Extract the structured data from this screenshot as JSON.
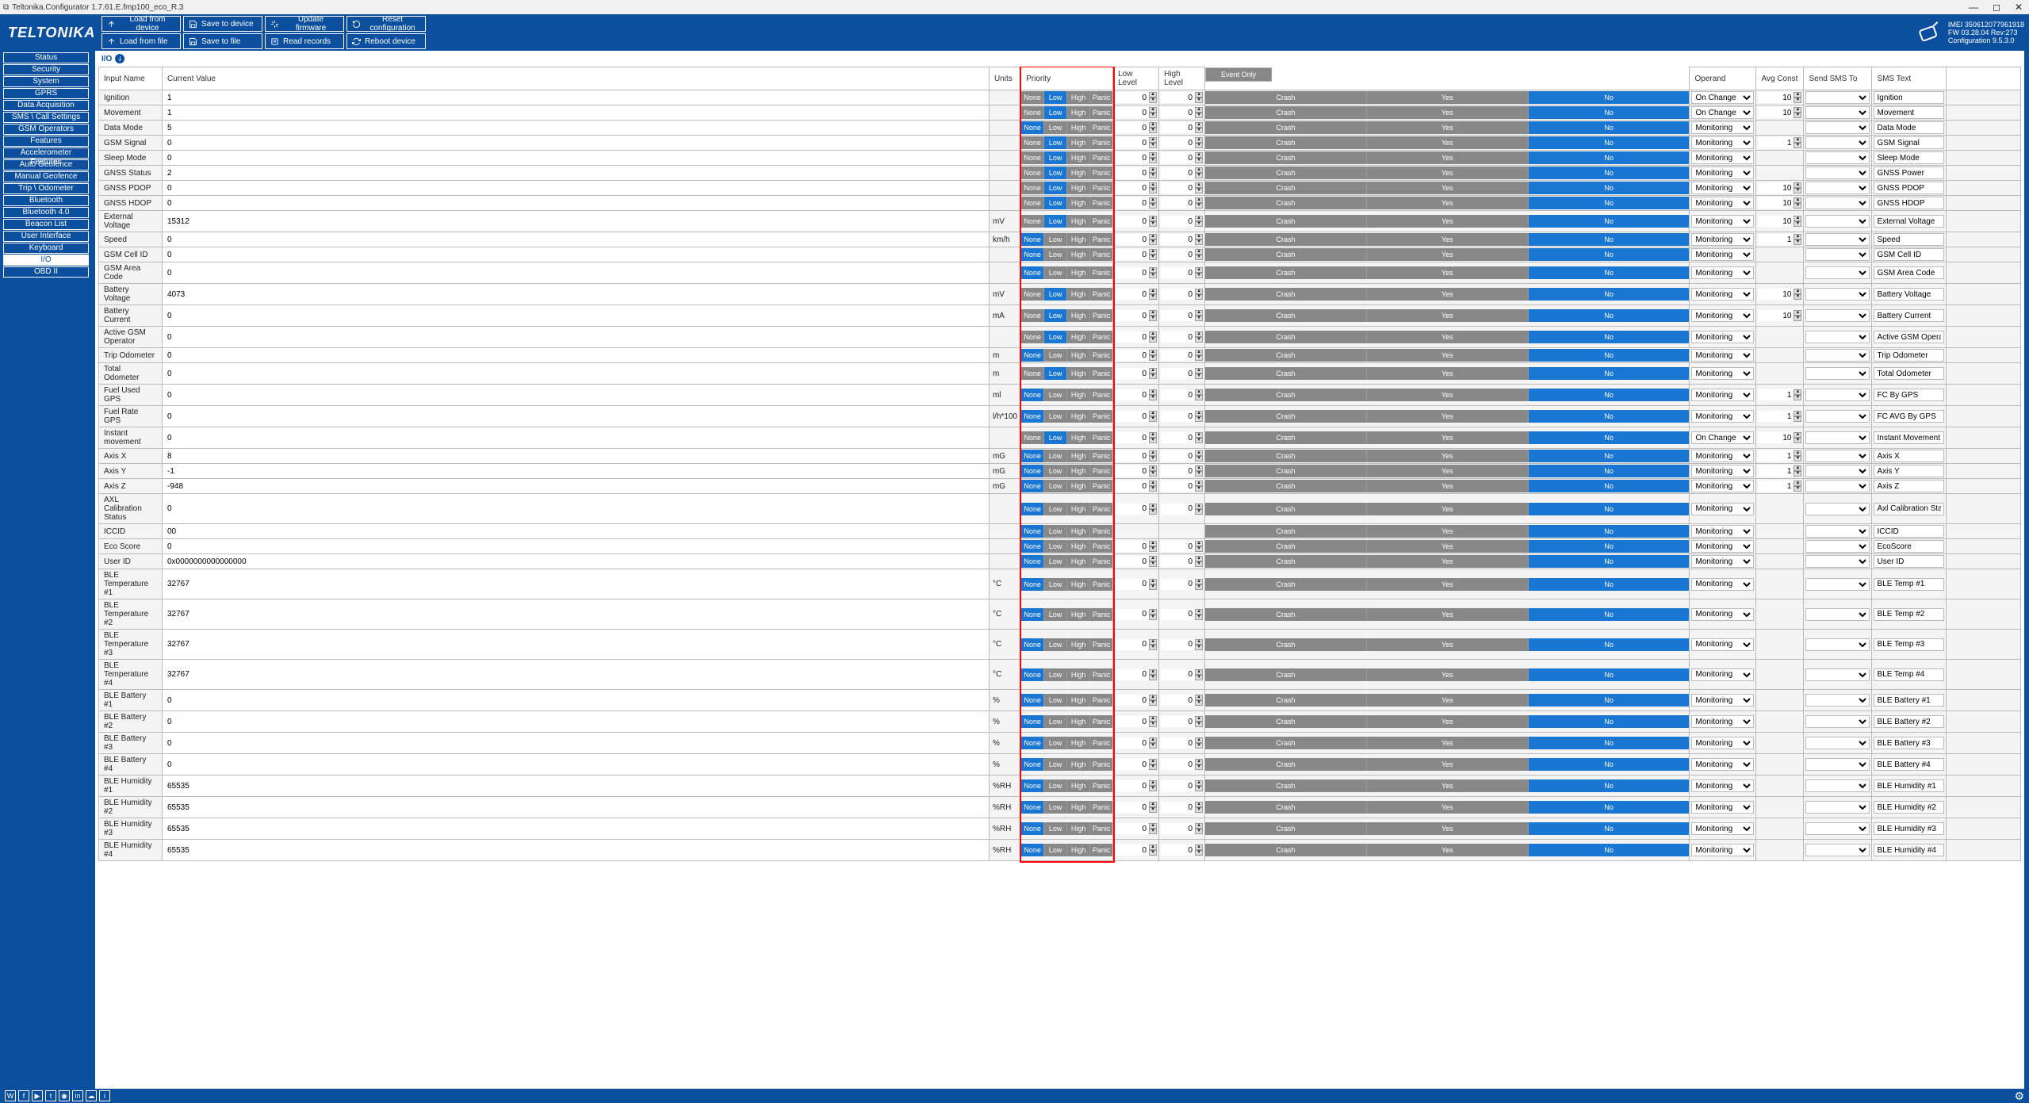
{
  "window_title": "Teltonika.Configurator 1.7.61.E.fmp100_eco_R.3",
  "logo": "TELTONIKA",
  "toolbar": {
    "r1": [
      {
        "t": "Load from device",
        "i": "up"
      },
      {
        "t": "Save to device",
        "i": "save"
      },
      {
        "t": "Update firmware",
        "i": "upd"
      },
      {
        "t": "Reset configuration",
        "i": "reset"
      }
    ],
    "r2": [
      {
        "t": "Load from file",
        "i": "up"
      },
      {
        "t": "Save to file",
        "i": "save"
      },
      {
        "t": "Read records",
        "i": "rec"
      },
      {
        "t": "Reboot device",
        "i": "reboot"
      }
    ]
  },
  "devinfo": {
    "imei": "IMEI 350612077961918",
    "fw": "FW 03.28.04 Rev:273",
    "cfg": "Configuration 9.5.3.0"
  },
  "sidebar": [
    "Status",
    "Security",
    "System",
    "GPRS",
    "Data Acquisition",
    "SMS \\ Call Settings",
    "GSM Operators",
    "Features",
    "Accelerometer Features",
    "Auto Geofence",
    "Manual Geofence",
    "Trip \\ Odometer",
    "Bluetooth",
    "Bluetooth 4.0",
    "Beacon List",
    "User Interface",
    "Keyboard",
    "I/O",
    "OBD II"
  ],
  "sidebar_active": "I/O",
  "page": "I/O",
  "headers": {
    "name": "Input Name",
    "val": "Current Value",
    "units": "Units",
    "prio": "Priority",
    "low": "Low Level",
    "high": "High Level",
    "ev": "Event Only",
    "op": "Operand",
    "avg": "Avg Const",
    "sms": "Send SMS To",
    "smstext": "SMS Text"
  },
  "prio_labels": [
    "None",
    "Low",
    "High",
    "Panic"
  ],
  "ev_labels": [
    "Crash",
    "Yes",
    "No"
  ],
  "rows": [
    {
      "name": "Ignition",
      "val": "1",
      "units": "",
      "prio": 1,
      "low": "0",
      "high": "0",
      "evsel": 2,
      "op": "On Change",
      "avg": "10",
      "smstext": "Ignition"
    },
    {
      "name": "Movement",
      "val": "1",
      "units": "",
      "prio": 1,
      "low": "0",
      "high": "0",
      "evsel": 2,
      "op": "On Change",
      "avg": "10",
      "smstext": "Movement"
    },
    {
      "name": "Data Mode",
      "val": "5",
      "units": "",
      "prio": 0,
      "low": "0",
      "high": "0",
      "evsel": 2,
      "op": "Monitoring",
      "avg": "",
      "smstext": "Data Mode"
    },
    {
      "name": "GSM Signal",
      "val": "0",
      "units": "",
      "prio": 1,
      "low": "0",
      "high": "0",
      "evsel": 2,
      "op": "Monitoring",
      "avg": "1",
      "smstext": "GSM Signal"
    },
    {
      "name": "Sleep Mode",
      "val": "0",
      "units": "",
      "prio": 1,
      "low": "0",
      "high": "0",
      "evsel": 2,
      "op": "Monitoring",
      "avg": "",
      "smstext": "Sleep Mode"
    },
    {
      "name": "GNSS Status",
      "val": "2",
      "units": "",
      "prio": 1,
      "low": "0",
      "high": "0",
      "evsel": 2,
      "op": "Monitoring",
      "avg": "",
      "smstext": "GNSS Power"
    },
    {
      "name": "GNSS PDOP",
      "val": "0",
      "units": "",
      "prio": 1,
      "low": "0",
      "high": "0",
      "evsel": 2,
      "op": "Monitoring",
      "avg": "10",
      "smstext": "GNSS PDOP"
    },
    {
      "name": "GNSS HDOP",
      "val": "0",
      "units": "",
      "prio": 1,
      "low": "0",
      "high": "0",
      "evsel": 2,
      "op": "Monitoring",
      "avg": "10",
      "smstext": "GNSS HDOP"
    },
    {
      "name": "External Voltage",
      "val": "15312",
      "units": "mV",
      "prio": 1,
      "low": "0",
      "high": "0",
      "evsel": 2,
      "op": "Monitoring",
      "avg": "10",
      "smstext": "External Voltage"
    },
    {
      "name": "Speed",
      "val": "0",
      "units": "km/h",
      "prio": 0,
      "low": "0",
      "high": "0",
      "evsel": 2,
      "op": "Monitoring",
      "avg": "1",
      "smstext": "Speed"
    },
    {
      "name": "GSM Cell ID",
      "val": "0",
      "units": "",
      "prio": 0,
      "low": "0",
      "high": "0",
      "evsel": 2,
      "op": "Monitoring",
      "avg": "",
      "smstext": "GSM Cell ID"
    },
    {
      "name": "GSM Area Code",
      "val": "0",
      "units": "",
      "prio": 0,
      "low": "0",
      "high": "0",
      "evsel": 2,
      "op": "Monitoring",
      "avg": "",
      "smstext": "GSM Area Code"
    },
    {
      "name": "Battery Voltage",
      "val": "4073",
      "units": "mV",
      "prio": 1,
      "low": "0",
      "high": "0",
      "evsel": 2,
      "op": "Monitoring",
      "avg": "10",
      "smstext": "Battery Voltage"
    },
    {
      "name": "Battery Current",
      "val": "0",
      "units": "mA",
      "prio": 1,
      "low": "0",
      "high": "0",
      "evsel": 2,
      "op": "Monitoring",
      "avg": "10",
      "smstext": "Battery Current"
    },
    {
      "name": "Active GSM Operator",
      "val": "0",
      "units": "",
      "prio": 1,
      "low": "0",
      "high": "0",
      "evsel": 2,
      "op": "Monitoring",
      "avg": "",
      "smstext": "Active GSM Operator"
    },
    {
      "name": "Trip Odometer",
      "val": "0",
      "units": "m",
      "prio": 0,
      "low": "0",
      "high": "0",
      "evsel": 2,
      "op": "Monitoring",
      "avg": "",
      "smstext": "Trip Odometer"
    },
    {
      "name": "Total Odometer",
      "val": "0",
      "units": "m",
      "prio": 1,
      "low": "0",
      "high": "0",
      "evsel": 2,
      "op": "Monitoring",
      "avg": "",
      "smstext": "Total Odometer"
    },
    {
      "name": "Fuel Used GPS",
      "val": "0",
      "units": "ml",
      "prio": 0,
      "low": "0",
      "high": "0",
      "evsel": 2,
      "op": "Monitoring",
      "avg": "1",
      "smstext": "FC By GPS"
    },
    {
      "name": "Fuel Rate GPS",
      "val": "0",
      "units": "l/h*100",
      "prio": 0,
      "low": "0",
      "high": "0",
      "evsel": 2,
      "op": "Monitoring",
      "avg": "1",
      "smstext": "FC AVG By GPS"
    },
    {
      "name": "Instant movement",
      "val": "0",
      "units": "",
      "prio": 1,
      "low": "0",
      "high": "0",
      "evsel": 2,
      "op": "On Change",
      "avg": "10",
      "smstext": "Instant Movement"
    },
    {
      "name": "Axis X",
      "val": "8",
      "units": "mG",
      "prio": 0,
      "low": "0",
      "high": "0",
      "evsel": 2,
      "op": "Monitoring",
      "avg": "1",
      "smstext": "Axis X"
    },
    {
      "name": "Axis Y",
      "val": "-1",
      "units": "mG",
      "prio": 0,
      "low": "0",
      "high": "0",
      "evsel": 2,
      "op": "Monitoring",
      "avg": "1",
      "smstext": "Axis Y"
    },
    {
      "name": "Axis Z",
      "val": "-948",
      "units": "mG",
      "prio": 0,
      "low": "0",
      "high": "0",
      "evsel": 2,
      "op": "Monitoring",
      "avg": "1",
      "smstext": "Axis Z"
    },
    {
      "name": "AXL Calibration Status",
      "val": "0",
      "units": "",
      "prio": 0,
      "low": "0",
      "high": "0",
      "evsel": 2,
      "op": "Monitoring",
      "avg": "",
      "smstext": "Axl Calibration Status"
    },
    {
      "name": "ICCID",
      "val": "00",
      "units": "",
      "prio": 0,
      "low": null,
      "high": null,
      "evsel": 2,
      "op": "Monitoring",
      "avg": "",
      "smstext": "ICCID"
    },
    {
      "name": "Eco Score",
      "val": "0",
      "units": "",
      "prio": 0,
      "low": "0",
      "high": "0",
      "evsel": 2,
      "op": "Monitoring",
      "avg": "",
      "smstext": "EcoScore"
    },
    {
      "name": "User ID",
      "val": "0x0000000000000000",
      "units": "",
      "prio": 0,
      "low": "0",
      "high": "0",
      "evsel": 2,
      "op": "Monitoring",
      "avg": "",
      "smstext": "User ID"
    },
    {
      "name": "BLE Temperature #1",
      "val": "32767",
      "units": "°C",
      "prio": 0,
      "low": "0",
      "high": "0",
      "evsel": 2,
      "op": "Monitoring",
      "avg": "",
      "smstext": "BLE Temp #1"
    },
    {
      "name": "BLE Temperature #2",
      "val": "32767",
      "units": "°C",
      "prio": 0,
      "low": "0",
      "high": "0",
      "evsel": 2,
      "op": "Monitoring",
      "avg": "",
      "smstext": "BLE Temp #2"
    },
    {
      "name": "BLE Temperature #3",
      "val": "32767",
      "units": "°C",
      "prio": 0,
      "low": "0",
      "high": "0",
      "evsel": 2,
      "op": "Monitoring",
      "avg": "",
      "smstext": "BLE Temp #3"
    },
    {
      "name": "BLE Temperature #4",
      "val": "32767",
      "units": "°C",
      "prio": 0,
      "low": "0",
      "high": "0",
      "evsel": 2,
      "op": "Monitoring",
      "avg": "",
      "smstext": "BLE Temp #4"
    },
    {
      "name": "BLE Battery #1",
      "val": "0",
      "units": "%",
      "prio": 0,
      "low": "0",
      "high": "0",
      "evsel": 2,
      "op": "Monitoring",
      "avg": "",
      "smstext": "BLE Battery #1"
    },
    {
      "name": "BLE Battery #2",
      "val": "0",
      "units": "%",
      "prio": 0,
      "low": "0",
      "high": "0",
      "evsel": 2,
      "op": "Monitoring",
      "avg": "",
      "smstext": "BLE Battery #2"
    },
    {
      "name": "BLE Battery #3",
      "val": "0",
      "units": "%",
      "prio": 0,
      "low": "0",
      "high": "0",
      "evsel": 2,
      "op": "Monitoring",
      "avg": "",
      "smstext": "BLE Battery #3"
    },
    {
      "name": "BLE Battery #4",
      "val": "0",
      "units": "%",
      "prio": 0,
      "low": "0",
      "high": "0",
      "evsel": 2,
      "op": "Monitoring",
      "avg": "",
      "smstext": "BLE Battery #4"
    },
    {
      "name": "BLE Humidity #1",
      "val": "65535",
      "units": "%RH",
      "prio": 0,
      "low": "0",
      "high": "0",
      "evsel": 2,
      "op": "Monitoring",
      "avg": "",
      "smstext": "BLE Humidity #1"
    },
    {
      "name": "BLE Humidity #2",
      "val": "65535",
      "units": "%RH",
      "prio": 0,
      "low": "0",
      "high": "0",
      "evsel": 2,
      "op": "Monitoring",
      "avg": "",
      "smstext": "BLE Humidity #2"
    },
    {
      "name": "BLE Humidity #3",
      "val": "65535",
      "units": "%RH",
      "prio": 0,
      "low": "0",
      "high": "0",
      "evsel": 2,
      "op": "Monitoring",
      "avg": "",
      "smstext": "BLE Humidity #3"
    },
    {
      "name": "BLE Humidity #4",
      "val": "65535",
      "units": "%RH",
      "prio": 0,
      "low": "0",
      "high": "0",
      "evsel": 2,
      "op": "Monitoring",
      "avg": "",
      "smstext": "BLE Humidity #4"
    }
  ],
  "footer_icons": [
    "wiki",
    "facebook",
    "youtube",
    "twitter",
    "instagram",
    "linkedin",
    "cloud",
    "info"
  ]
}
